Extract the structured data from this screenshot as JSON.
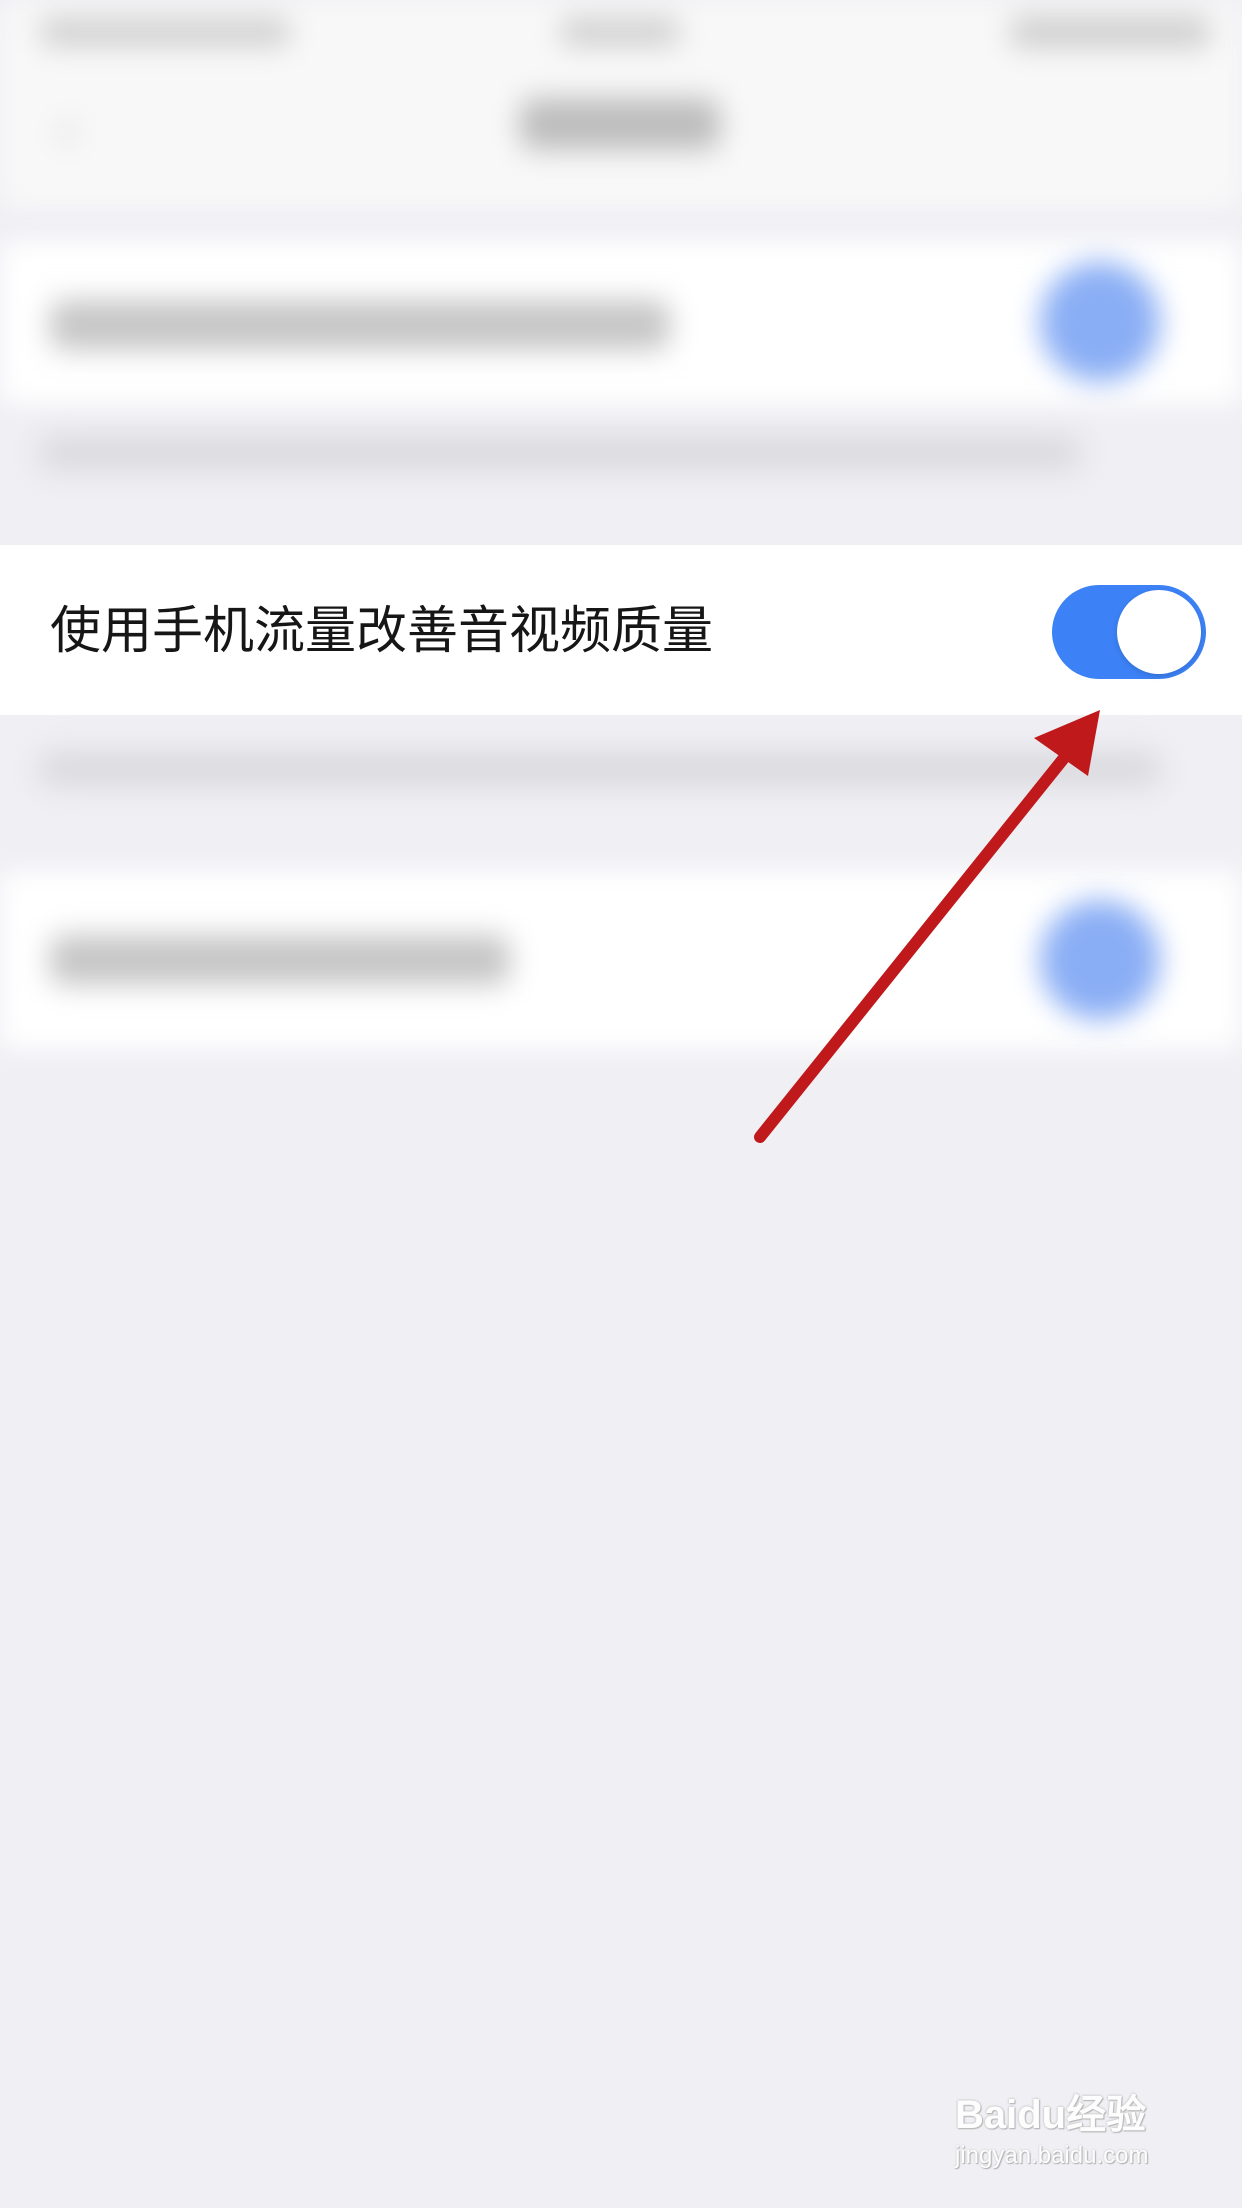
{
  "settings": {
    "cellular_av_quality": {
      "label": "使用手机流量改善音视频质量",
      "enabled": true
    }
  },
  "colors": {
    "toggle_on": "#3c82f6",
    "background": "#efeff4",
    "arrow": "#c0191b"
  },
  "icons": {
    "back": "chevron-left-icon",
    "annotation": "red-arrow-icon"
  },
  "watermark": {
    "main": "Baidu经验",
    "sub": "jingyan.baidu.com"
  }
}
